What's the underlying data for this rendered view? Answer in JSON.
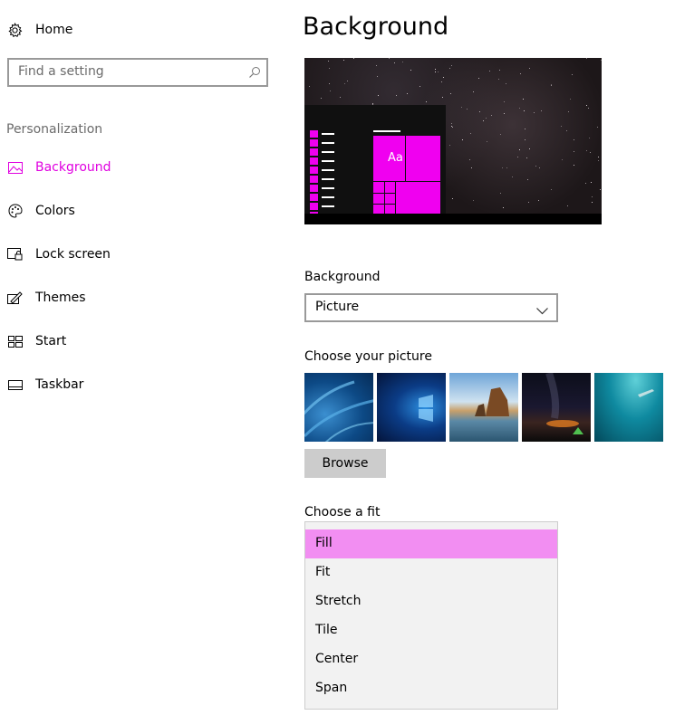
{
  "sidebar": {
    "home_label": "Home",
    "search_placeholder": "Find a setting",
    "section_title": "Personalization",
    "items": [
      {
        "label": "Background",
        "icon": "picture-icon",
        "active": true
      },
      {
        "label": "Colors",
        "icon": "palette-icon",
        "active": false
      },
      {
        "label": "Lock screen",
        "icon": "lock-screen-icon",
        "active": false
      },
      {
        "label": "Themes",
        "icon": "themes-icon",
        "active": false
      },
      {
        "label": "Start",
        "icon": "start-icon",
        "active": false
      },
      {
        "label": "Taskbar",
        "icon": "taskbar-icon",
        "active": false
      }
    ]
  },
  "main": {
    "title": "Background",
    "preview": {
      "sample_text": "Aa"
    },
    "background_label": "Background",
    "background_value": "Picture",
    "choose_picture_label": "Choose your picture",
    "pictures": [
      "feathers",
      "windows-logo",
      "beach-rocks",
      "night-sky-tent",
      "underwater-swimmer"
    ],
    "browse_label": "Browse",
    "fit_label": "Choose a fit",
    "fit_options": [
      "Fill",
      "Fit",
      "Stretch",
      "Tile",
      "Center",
      "Span"
    ],
    "fit_selected": "Fill"
  },
  "colors": {
    "accent": "#e000e0",
    "selected_option_bg": "#f28ef2"
  }
}
